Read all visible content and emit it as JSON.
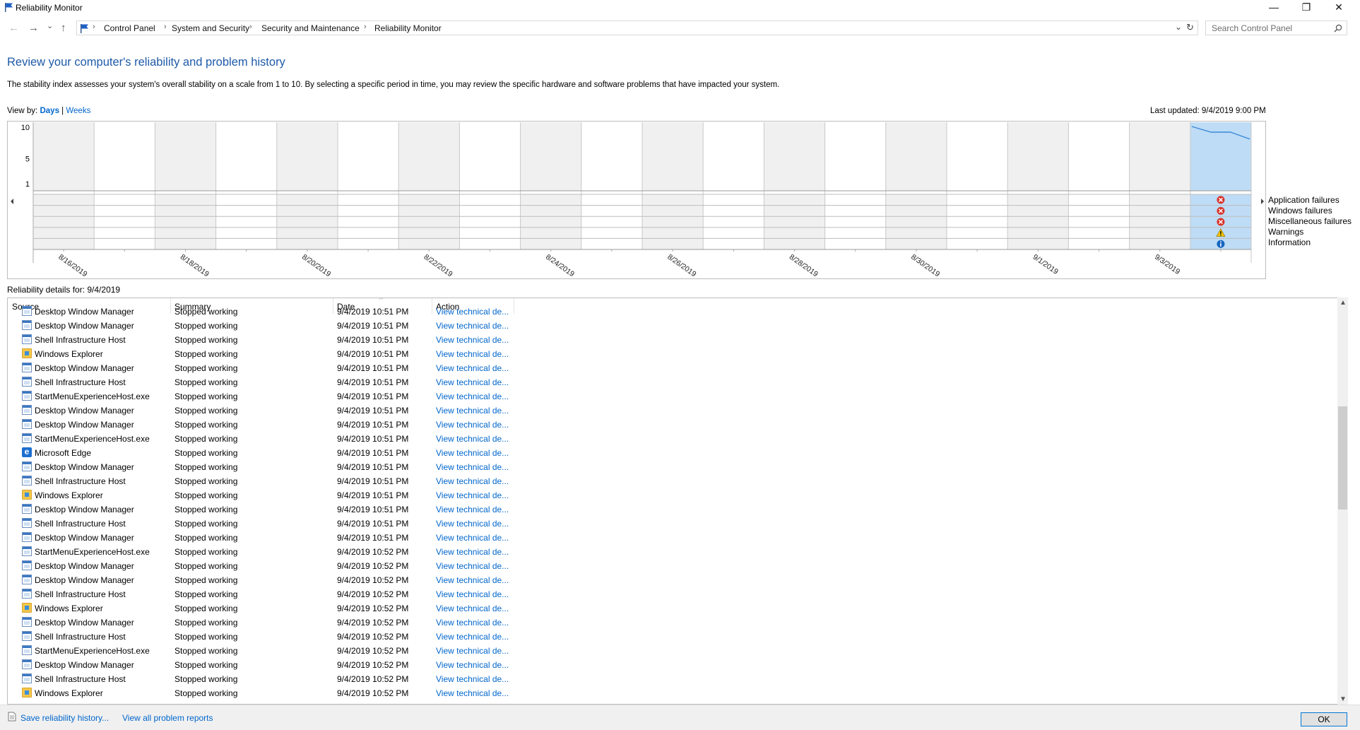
{
  "window": {
    "title": "Reliability Monitor",
    "minimize": "—",
    "restore": "❐",
    "close": "✕"
  },
  "nav": {
    "back": "←",
    "forward": "→",
    "recent": "⌄",
    "up": "↑",
    "dropdown": "⌄",
    "refresh": "↻"
  },
  "breadcrumb": [
    "Control Panel",
    "System and Security",
    "Security and Maintenance",
    "Reliability Monitor"
  ],
  "search": {
    "placeholder": "Search Control Panel"
  },
  "page": {
    "title": "Review your computer's reliability and problem history",
    "description": "The stability index assesses your system's overall stability on a scale from 1 to 10. By selecting a specific period in time, you may review the specific hardware and software problems that have impacted your system.",
    "view_by_label": "View by:",
    "view_days": "Days",
    "view_sep": "|",
    "view_weeks": "Weeks",
    "last_updated": "Last updated: 9/4/2019 9:00 PM",
    "details_label": "Reliability details for: 9/4/2019"
  },
  "chart_data": {
    "type": "line",
    "y_ticks": [
      "10",
      "5",
      "1"
    ],
    "ylim": [
      1,
      10
    ],
    "date_labels": [
      "8/16/2019",
      "8/18/2019",
      "8/20/2019",
      "8/22/2019",
      "8/24/2019",
      "8/26/2019",
      "8/28/2019",
      "8/30/2019",
      "9/1/2019",
      "9/3/2019"
    ],
    "selected_day": "9/4/2019",
    "series": [
      {
        "x": [
          "9/4/2019",
          "9/4/2019",
          "9/4/2019",
          "9/4/2019"
        ],
        "values": [
          10,
          9.1,
          9.1,
          8.0
        ]
      }
    ],
    "legend": [
      "Application failures",
      "Windows failures",
      "Miscellaneous failures",
      "Warnings",
      "Information"
    ],
    "events_selected_day": [
      "error",
      "error",
      "error",
      "warning",
      "info"
    ],
    "colors": {
      "selected": "#bedcf5",
      "alt_column": "#f0f0f0",
      "line": "#3c8ad8",
      "error": "#d9342b",
      "warning": "#f4c400",
      "info": "#1565c0"
    }
  },
  "table": {
    "columns": [
      "Source",
      "Summary",
      "Date",
      "Action"
    ],
    "rows": [
      {
        "icon": "app",
        "source": "Desktop Window Manager",
        "summary": "Stopped working",
        "date": "9/4/2019 10:51 PM",
        "action": "View technical de..."
      },
      {
        "icon": "app",
        "source": "Desktop Window Manager",
        "summary": "Stopped working",
        "date": "9/4/2019 10:51 PM",
        "action": "View technical de..."
      },
      {
        "icon": "app",
        "source": "Shell Infrastructure Host",
        "summary": "Stopped working",
        "date": "9/4/2019 10:51 PM",
        "action": "View technical de..."
      },
      {
        "icon": "folder",
        "source": "Windows Explorer",
        "summary": "Stopped working",
        "date": "9/4/2019 10:51 PM",
        "action": "View technical de..."
      },
      {
        "icon": "app",
        "source": "Desktop Window Manager",
        "summary": "Stopped working",
        "date": "9/4/2019 10:51 PM",
        "action": "View technical de..."
      },
      {
        "icon": "app",
        "source": "Shell Infrastructure Host",
        "summary": "Stopped working",
        "date": "9/4/2019 10:51 PM",
        "action": "View technical de..."
      },
      {
        "icon": "app",
        "source": "StartMenuExperienceHost.exe",
        "summary": "Stopped working",
        "date": "9/4/2019 10:51 PM",
        "action": "View technical de..."
      },
      {
        "icon": "app",
        "source": "Desktop Window Manager",
        "summary": "Stopped working",
        "date": "9/4/2019 10:51 PM",
        "action": "View technical de..."
      },
      {
        "icon": "app",
        "source": "Desktop Window Manager",
        "summary": "Stopped working",
        "date": "9/4/2019 10:51 PM",
        "action": "View technical de..."
      },
      {
        "icon": "app",
        "source": "StartMenuExperienceHost.exe",
        "summary": "Stopped working",
        "date": "9/4/2019 10:51 PM",
        "action": "View technical de..."
      },
      {
        "icon": "edge",
        "source": "Microsoft Edge",
        "summary": "Stopped working",
        "date": "9/4/2019 10:51 PM",
        "action": "View technical de..."
      },
      {
        "icon": "app",
        "source": "Desktop Window Manager",
        "summary": "Stopped working",
        "date": "9/4/2019 10:51 PM",
        "action": "View technical de..."
      },
      {
        "icon": "app",
        "source": "Shell Infrastructure Host",
        "summary": "Stopped working",
        "date": "9/4/2019 10:51 PM",
        "action": "View technical de..."
      },
      {
        "icon": "folder",
        "source": "Windows Explorer",
        "summary": "Stopped working",
        "date": "9/4/2019 10:51 PM",
        "action": "View technical de..."
      },
      {
        "icon": "app",
        "source": "Desktop Window Manager",
        "summary": "Stopped working",
        "date": "9/4/2019 10:51 PM",
        "action": "View technical de..."
      },
      {
        "icon": "app",
        "source": "Shell Infrastructure Host",
        "summary": "Stopped working",
        "date": "9/4/2019 10:51 PM",
        "action": "View technical de..."
      },
      {
        "icon": "app",
        "source": "Desktop Window Manager",
        "summary": "Stopped working",
        "date": "9/4/2019 10:51 PM",
        "action": "View technical de..."
      },
      {
        "icon": "app",
        "source": "StartMenuExperienceHost.exe",
        "summary": "Stopped working",
        "date": "9/4/2019 10:52 PM",
        "action": "View technical de..."
      },
      {
        "icon": "app",
        "source": "Desktop Window Manager",
        "summary": "Stopped working",
        "date": "9/4/2019 10:52 PM",
        "action": "View technical de..."
      },
      {
        "icon": "app",
        "source": "Desktop Window Manager",
        "summary": "Stopped working",
        "date": "9/4/2019 10:52 PM",
        "action": "View technical de..."
      },
      {
        "icon": "app",
        "source": "Shell Infrastructure Host",
        "summary": "Stopped working",
        "date": "9/4/2019 10:52 PM",
        "action": "View technical de..."
      },
      {
        "icon": "folder",
        "source": "Windows Explorer",
        "summary": "Stopped working",
        "date": "9/4/2019 10:52 PM",
        "action": "View technical de..."
      },
      {
        "icon": "app",
        "source": "Desktop Window Manager",
        "summary": "Stopped working",
        "date": "9/4/2019 10:52 PM",
        "action": "View technical de..."
      },
      {
        "icon": "app",
        "source": "Shell Infrastructure Host",
        "summary": "Stopped working",
        "date": "9/4/2019 10:52 PM",
        "action": "View technical de..."
      },
      {
        "icon": "app",
        "source": "StartMenuExperienceHost.exe",
        "summary": "Stopped working",
        "date": "9/4/2019 10:52 PM",
        "action": "View technical de..."
      },
      {
        "icon": "app",
        "source": "Desktop Window Manager",
        "summary": "Stopped working",
        "date": "9/4/2019 10:52 PM",
        "action": "View technical de..."
      },
      {
        "icon": "app",
        "source": "Shell Infrastructure Host",
        "summary": "Stopped working",
        "date": "9/4/2019 10:52 PM",
        "action": "View technical de..."
      },
      {
        "icon": "folder",
        "source": "Windows Explorer",
        "summary": "Stopped working",
        "date": "9/4/2019 10:52 PM",
        "action": "View technical de..."
      }
    ]
  },
  "footer": {
    "save_history": "Save reliability history...",
    "view_all": "View all problem reports",
    "ok": "OK"
  }
}
